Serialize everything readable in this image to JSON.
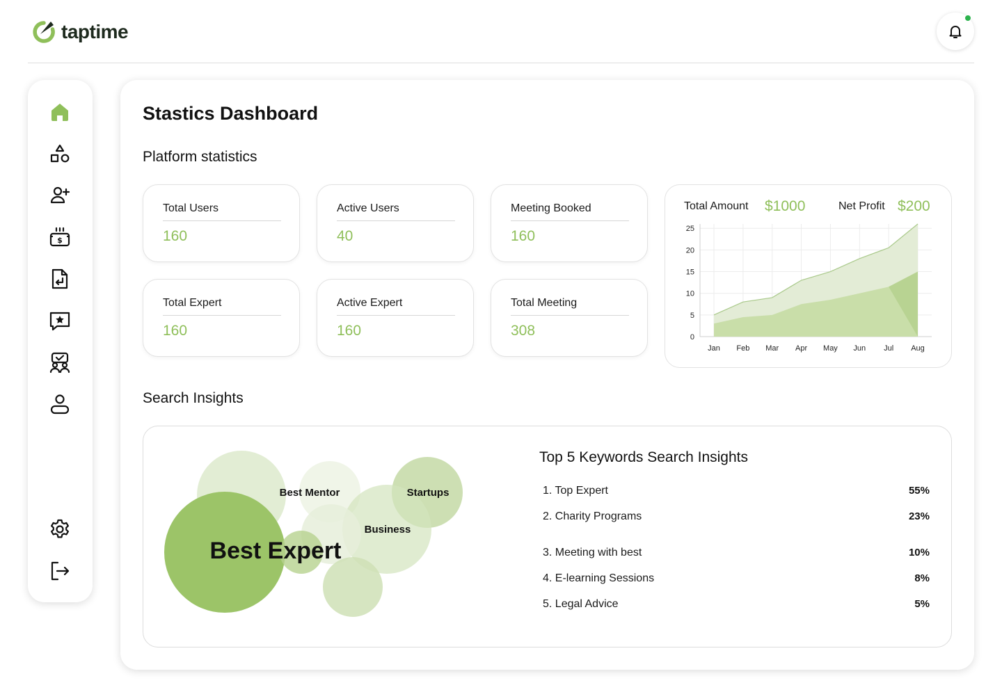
{
  "header": {
    "logo_text": "taptime",
    "notification_indicator": true
  },
  "sidebar": {
    "items": [
      {
        "name": "home",
        "icon": "home-icon",
        "active": true
      },
      {
        "name": "categories",
        "icon": "shapes-icon"
      },
      {
        "name": "add-user",
        "icon": "user-plus-icon"
      },
      {
        "name": "payments",
        "icon": "money-box-icon"
      },
      {
        "name": "documents",
        "icon": "document-return-icon"
      },
      {
        "name": "reviews",
        "icon": "star-message-icon"
      },
      {
        "name": "sessions",
        "icon": "meeting-check-icon"
      },
      {
        "name": "profile",
        "icon": "user-icon"
      }
    ],
    "bottom_items": [
      {
        "name": "settings",
        "icon": "gear-icon"
      },
      {
        "name": "logout",
        "icon": "logout-icon"
      }
    ]
  },
  "main": {
    "title": "Stastics Dashboard",
    "platform_title": "Platform statistics",
    "stats": [
      {
        "label": "Total Users",
        "value": "160"
      },
      {
        "label": "Active Users",
        "value": "40"
      },
      {
        "label": "Meeting Booked",
        "value": "160"
      },
      {
        "label": "Total Expert",
        "value": "160"
      },
      {
        "label": "Active Expert",
        "value": "160"
      },
      {
        "label": "Total Meeting",
        "value": "308"
      }
    ],
    "search_title": "Search Insights"
  },
  "amount_chart": {
    "total_label": "Total Amount",
    "total_value": "$1000",
    "profit_label": "Net Profit",
    "profit_value": "$200"
  },
  "chart_data": {
    "type": "area",
    "categories": [
      "Jan",
      "Feb",
      "Mar",
      "Apr",
      "May",
      "Jun",
      "Jul",
      "Aug"
    ],
    "yticks": [
      0,
      5,
      10,
      15,
      20,
      25
    ],
    "ylim": [
      0,
      26
    ],
    "grid": true,
    "series": [
      {
        "values": [
          5,
          8,
          9,
          13,
          15,
          18,
          20.5,
          26
        ]
      },
      {
        "values": [
          3,
          4.5,
          5,
          7.5,
          8.5,
          10,
          11.5,
          15
        ]
      }
    ],
    "colors": {
      "upper": "#e3ecd6",
      "lower": "#c9dea9",
      "line": "#a9c98a"
    }
  },
  "insights": {
    "bubbles": [
      "Best Mentor",
      "Startups",
      "Business",
      "Best Expert"
    ],
    "title": "Top 5 Keywords Search Insights",
    "keywords": [
      {
        "label": "1. Top Expert",
        "percent": "55%"
      },
      {
        "label": "2. Charity Programs",
        "percent": "23%"
      },
      {
        "label": "3. Meeting with best",
        "percent": "10%"
      },
      {
        "label": "4. E-learning Sessions",
        "percent": "8%"
      },
      {
        "label": "5. Legal Advice",
        "percent": "5%"
      }
    ]
  },
  "colors": {
    "accent": "#8fbf5a",
    "accent_dark": "#9cc468",
    "notification": "#2bb24c"
  }
}
